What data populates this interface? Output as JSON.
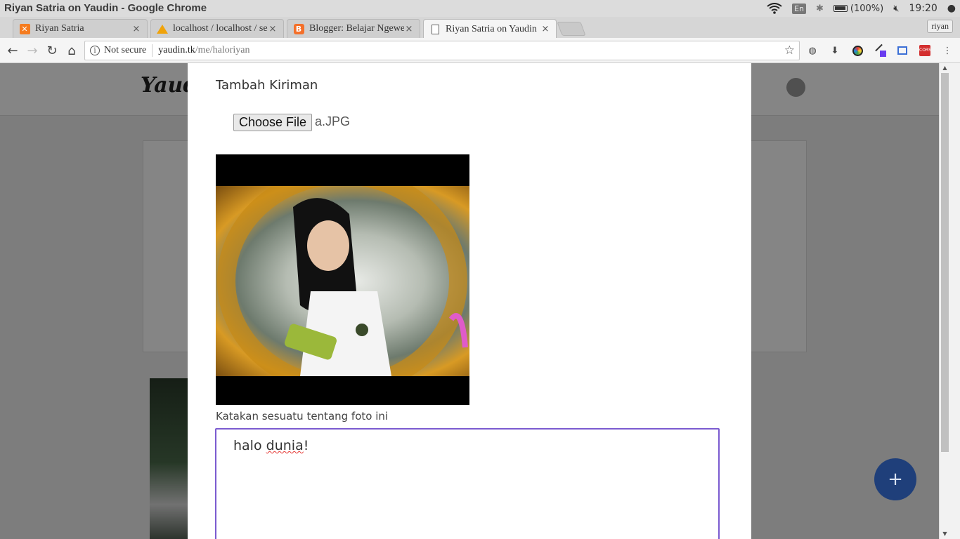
{
  "window": {
    "title": "Riyan Satria on Yaudin - Google Chrome"
  },
  "tray": {
    "lang": "En",
    "battery": "(100%)",
    "clock": "19:20"
  },
  "tabs": [
    {
      "label": "Riyan Satria",
      "close": "×"
    },
    {
      "label": "localhost / localhost / sek",
      "close": "×"
    },
    {
      "label": "Blogger: Belajar Ngeweb",
      "close": "×"
    },
    {
      "label": "Riyan Satria on Yaudin",
      "close": "×"
    }
  ],
  "profile": "riyan",
  "omnibox": {
    "secure": "Not secure",
    "host": "yaudin.tk",
    "path": "/me/haloriyan"
  },
  "site": {
    "logo": "Yaudi"
  },
  "modal": {
    "title": "Tambah Kiriman",
    "file_button": "Choose File",
    "file_name": "a.JPG",
    "caption_label": "Katakan sesuatu tentang foto ini",
    "caption_prefix": "halo ",
    "caption_word": "dunia",
    "caption_suffix": "!"
  },
  "fab": {
    "label": "+"
  }
}
